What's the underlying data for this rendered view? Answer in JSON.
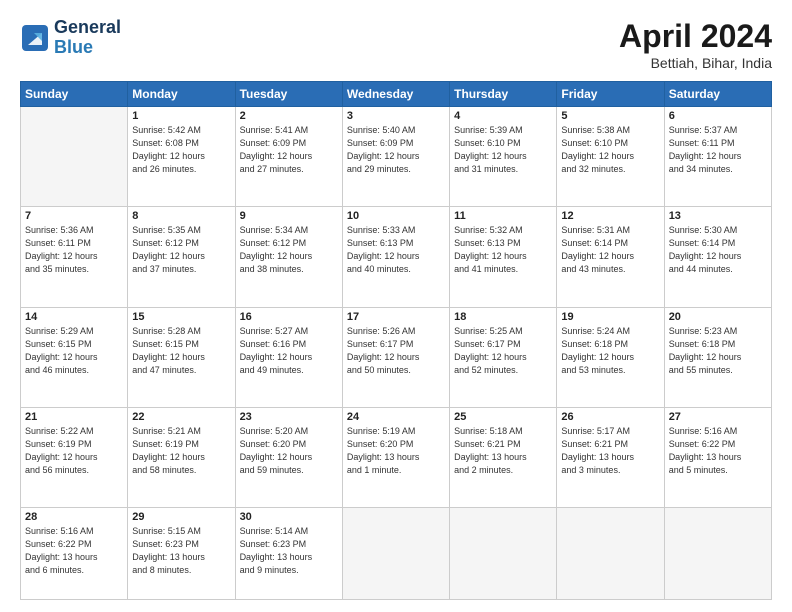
{
  "header": {
    "logo_line1": "General",
    "logo_line2": "Blue",
    "month_year": "April 2024",
    "location": "Bettiah, Bihar, India"
  },
  "days_of_week": [
    "Sunday",
    "Monday",
    "Tuesday",
    "Wednesday",
    "Thursday",
    "Friday",
    "Saturday"
  ],
  "weeks": [
    [
      {
        "day": "",
        "info": ""
      },
      {
        "day": "1",
        "info": "Sunrise: 5:42 AM\nSunset: 6:08 PM\nDaylight: 12 hours\nand 26 minutes."
      },
      {
        "day": "2",
        "info": "Sunrise: 5:41 AM\nSunset: 6:09 PM\nDaylight: 12 hours\nand 27 minutes."
      },
      {
        "day": "3",
        "info": "Sunrise: 5:40 AM\nSunset: 6:09 PM\nDaylight: 12 hours\nand 29 minutes."
      },
      {
        "day": "4",
        "info": "Sunrise: 5:39 AM\nSunset: 6:10 PM\nDaylight: 12 hours\nand 31 minutes."
      },
      {
        "day": "5",
        "info": "Sunrise: 5:38 AM\nSunset: 6:10 PM\nDaylight: 12 hours\nand 32 minutes."
      },
      {
        "day": "6",
        "info": "Sunrise: 5:37 AM\nSunset: 6:11 PM\nDaylight: 12 hours\nand 34 minutes."
      }
    ],
    [
      {
        "day": "7",
        "info": "Sunrise: 5:36 AM\nSunset: 6:11 PM\nDaylight: 12 hours\nand 35 minutes."
      },
      {
        "day": "8",
        "info": "Sunrise: 5:35 AM\nSunset: 6:12 PM\nDaylight: 12 hours\nand 37 minutes."
      },
      {
        "day": "9",
        "info": "Sunrise: 5:34 AM\nSunset: 6:12 PM\nDaylight: 12 hours\nand 38 minutes."
      },
      {
        "day": "10",
        "info": "Sunrise: 5:33 AM\nSunset: 6:13 PM\nDaylight: 12 hours\nand 40 minutes."
      },
      {
        "day": "11",
        "info": "Sunrise: 5:32 AM\nSunset: 6:13 PM\nDaylight: 12 hours\nand 41 minutes."
      },
      {
        "day": "12",
        "info": "Sunrise: 5:31 AM\nSunset: 6:14 PM\nDaylight: 12 hours\nand 43 minutes."
      },
      {
        "day": "13",
        "info": "Sunrise: 5:30 AM\nSunset: 6:14 PM\nDaylight: 12 hours\nand 44 minutes."
      }
    ],
    [
      {
        "day": "14",
        "info": "Sunrise: 5:29 AM\nSunset: 6:15 PM\nDaylight: 12 hours\nand 46 minutes."
      },
      {
        "day": "15",
        "info": "Sunrise: 5:28 AM\nSunset: 6:15 PM\nDaylight: 12 hours\nand 47 minutes."
      },
      {
        "day": "16",
        "info": "Sunrise: 5:27 AM\nSunset: 6:16 PM\nDaylight: 12 hours\nand 49 minutes."
      },
      {
        "day": "17",
        "info": "Sunrise: 5:26 AM\nSunset: 6:17 PM\nDaylight: 12 hours\nand 50 minutes."
      },
      {
        "day": "18",
        "info": "Sunrise: 5:25 AM\nSunset: 6:17 PM\nDaylight: 12 hours\nand 52 minutes."
      },
      {
        "day": "19",
        "info": "Sunrise: 5:24 AM\nSunset: 6:18 PM\nDaylight: 12 hours\nand 53 minutes."
      },
      {
        "day": "20",
        "info": "Sunrise: 5:23 AM\nSunset: 6:18 PM\nDaylight: 12 hours\nand 55 minutes."
      }
    ],
    [
      {
        "day": "21",
        "info": "Sunrise: 5:22 AM\nSunset: 6:19 PM\nDaylight: 12 hours\nand 56 minutes."
      },
      {
        "day": "22",
        "info": "Sunrise: 5:21 AM\nSunset: 6:19 PM\nDaylight: 12 hours\nand 58 minutes."
      },
      {
        "day": "23",
        "info": "Sunrise: 5:20 AM\nSunset: 6:20 PM\nDaylight: 12 hours\nand 59 minutes."
      },
      {
        "day": "24",
        "info": "Sunrise: 5:19 AM\nSunset: 6:20 PM\nDaylight: 13 hours\nand 1 minute."
      },
      {
        "day": "25",
        "info": "Sunrise: 5:18 AM\nSunset: 6:21 PM\nDaylight: 13 hours\nand 2 minutes."
      },
      {
        "day": "26",
        "info": "Sunrise: 5:17 AM\nSunset: 6:21 PM\nDaylight: 13 hours\nand 3 minutes."
      },
      {
        "day": "27",
        "info": "Sunrise: 5:16 AM\nSunset: 6:22 PM\nDaylight: 13 hours\nand 5 minutes."
      }
    ],
    [
      {
        "day": "28",
        "info": "Sunrise: 5:16 AM\nSunset: 6:22 PM\nDaylight: 13 hours\nand 6 minutes."
      },
      {
        "day": "29",
        "info": "Sunrise: 5:15 AM\nSunset: 6:23 PM\nDaylight: 13 hours\nand 8 minutes."
      },
      {
        "day": "30",
        "info": "Sunrise: 5:14 AM\nSunset: 6:23 PM\nDaylight: 13 hours\nand 9 minutes."
      },
      {
        "day": "",
        "info": ""
      },
      {
        "day": "",
        "info": ""
      },
      {
        "day": "",
        "info": ""
      },
      {
        "day": "",
        "info": ""
      }
    ]
  ]
}
